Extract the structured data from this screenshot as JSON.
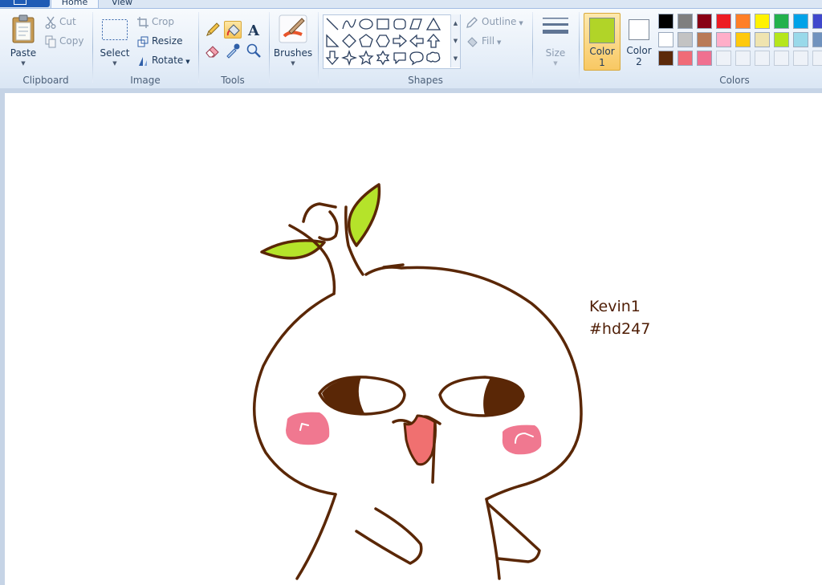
{
  "tabs": {
    "home": "Home",
    "view": "View"
  },
  "groups": {
    "clipboard": "Clipboard",
    "image": "Image",
    "tools": "Tools",
    "shapes": "Shapes",
    "colors": "Colors"
  },
  "clipboard": {
    "paste": "Paste",
    "cut": "Cut",
    "copy": "Copy"
  },
  "image": {
    "select": "Select",
    "crop": "Crop",
    "resize": "Resize",
    "rotate": "Rotate"
  },
  "tools": {
    "active": "fill-bucket"
  },
  "brushes": {
    "label": "Brushes"
  },
  "shapes": {
    "outline": "Outline",
    "fill": "Fill"
  },
  "size": {
    "label": "Size"
  },
  "colors": {
    "color1_label": "Color",
    "color1_num": "1",
    "color1_value": "#b1d428",
    "color2_label": "Color",
    "color2_num": "2",
    "color2_value": "#ffffff",
    "palette_row1": [
      "#000000",
      "#7f7f7f",
      "#880015",
      "#ed1c24",
      "#ff7f27",
      "#fff200",
      "#22b14c",
      "#00a2e8",
      "#3f48cc"
    ],
    "palette_row2": [
      "#ffffff",
      "#c3c3c3",
      "#b97a57",
      "#ffaec9",
      "#ffc90e",
      "#efe4b0",
      "#b5e61d",
      "#99d9ea",
      "#7092be"
    ],
    "palette_row3": [
      "#5c2a0a",
      "#f06b77",
      "#f07090",
      "",
      "",
      "",
      "",
      "",
      ""
    ]
  },
  "canvas": {
    "note_line1": "Kevin1",
    "note_line2": "#hd247",
    "stroke_color": "#5a2706",
    "leaf_color": "#b5e32a",
    "cheek_color": "#f07890",
    "tongue_color": "#f07070"
  }
}
